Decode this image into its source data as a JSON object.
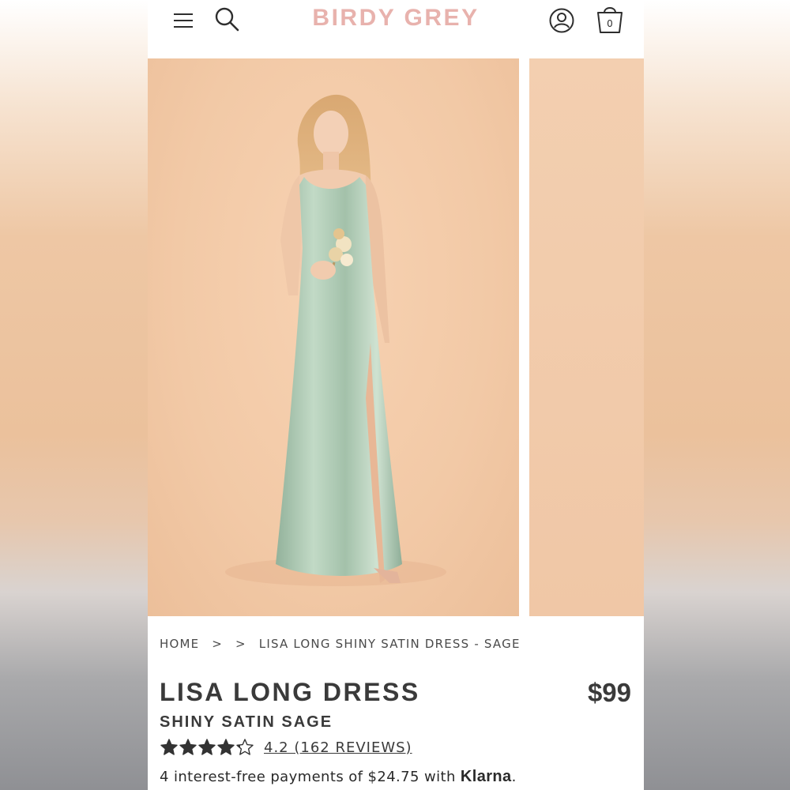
{
  "header": {
    "brand": "BIRDY GREY",
    "cart_count": "0",
    "icons": [
      "menu-icon",
      "search-icon",
      "account-icon",
      "shopping-bag-icon"
    ]
  },
  "breadcrumb": {
    "home": "HOME",
    "separator1": ">",
    "separator2": ">",
    "current": "LISA LONG SHINY SATIN DRESS - SAGE"
  },
  "product": {
    "name": "LISA LONG DRESS",
    "variant": "SHINY SATIN SAGE",
    "price": "$99",
    "rating_value": 4.2,
    "rating_max": 5,
    "rating_text": "4.2 (162 REVIEWS)"
  },
  "payment": {
    "text": "4 interest-free payments of $24.75 with",
    "provider": "Klarna",
    "suffix": "."
  },
  "colors": {
    "brand": "#e8b2ad",
    "text": "#3a3a3a",
    "photo_background": "#f2c9a6",
    "dress": "#a9c6ae"
  }
}
